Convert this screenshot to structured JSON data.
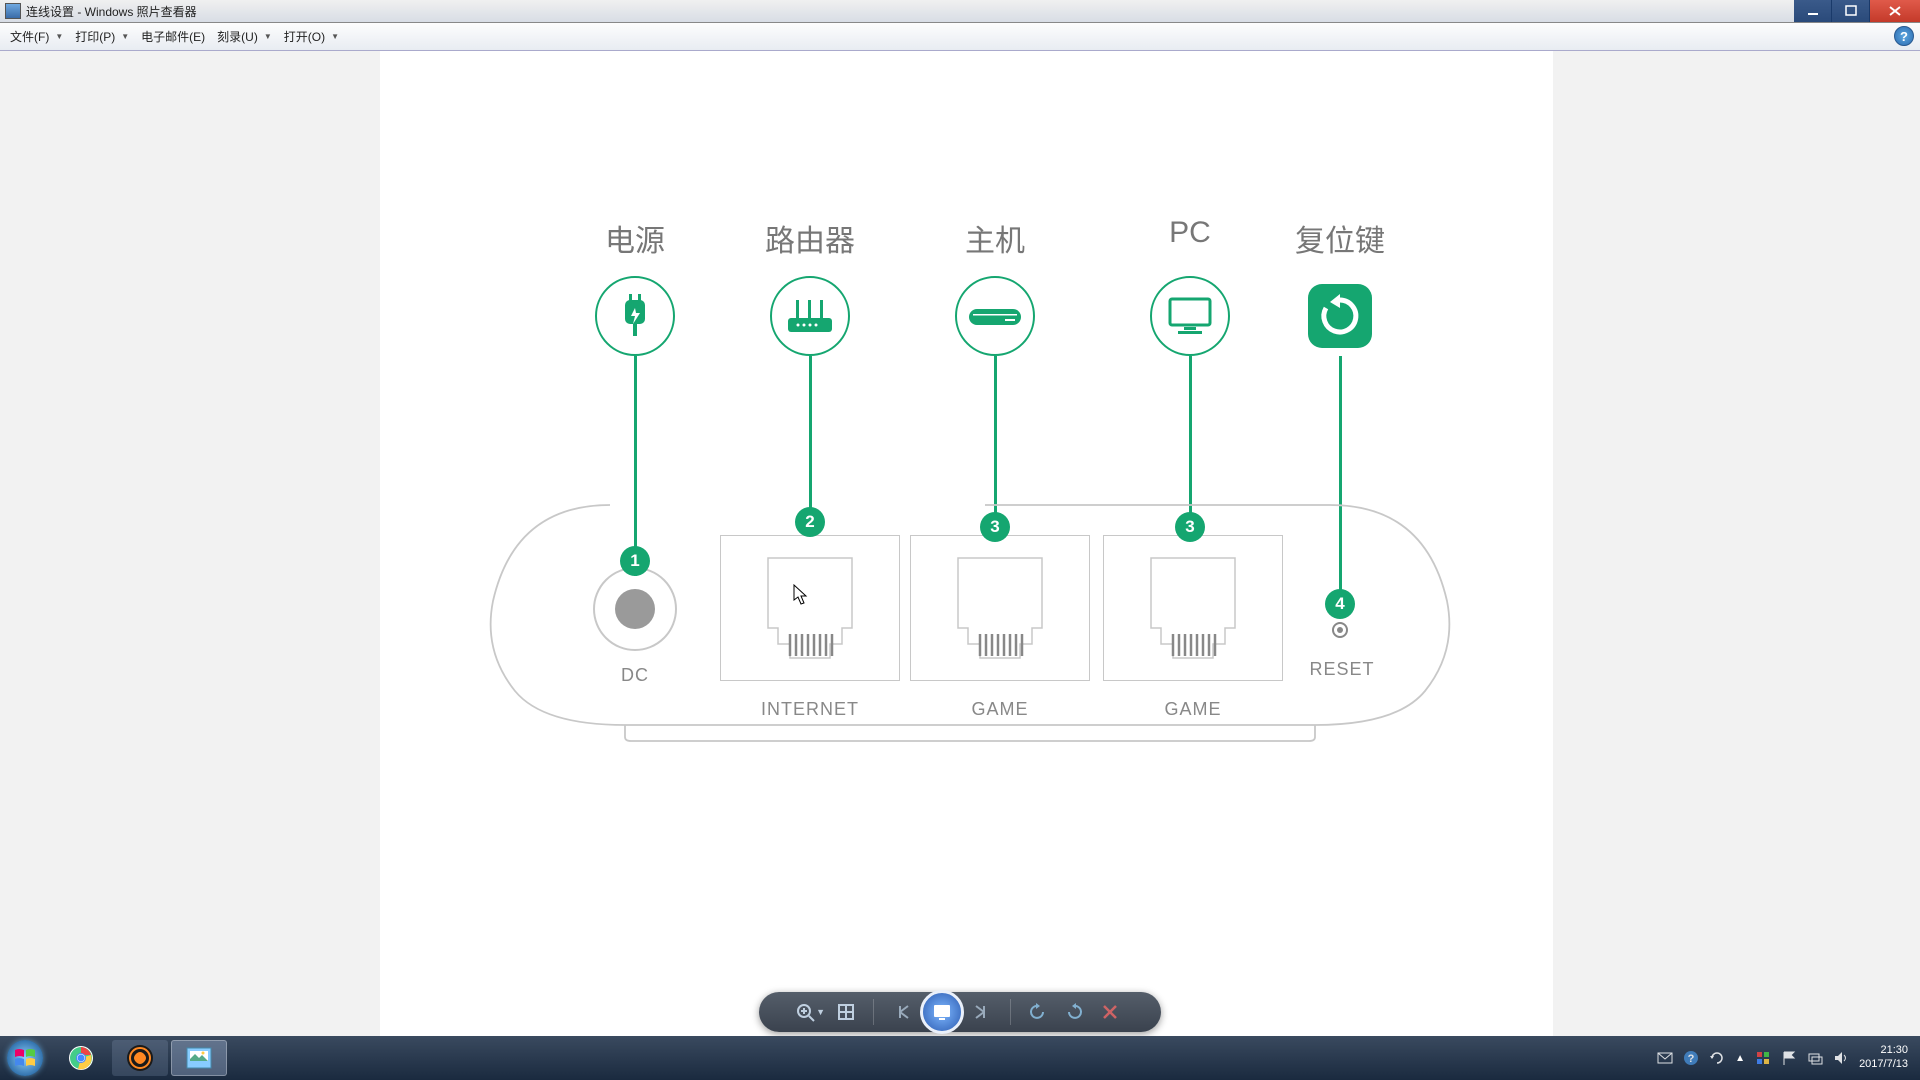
{
  "window": {
    "title": "连线设置 - Windows 照片查看器"
  },
  "menu": {
    "file": "文件(F)",
    "print": "打印(P)",
    "email": "电子邮件(E)",
    "burn": "刻录(U)",
    "open": "打开(O)"
  },
  "diagram": {
    "labels": {
      "power": "电源",
      "router": "路由器",
      "console": "主机",
      "pc": "PC",
      "reset": "复位键"
    },
    "ports": {
      "dc": "DC",
      "internet": "INTERNET",
      "game1": "GAME",
      "game2": "GAME",
      "reset": "RESET"
    },
    "steps": {
      "s1": "1",
      "s2": "2",
      "s3a": "3",
      "s3b": "3",
      "s4": "4"
    }
  },
  "tray": {
    "time": "21:30",
    "date": "2017/7/13"
  }
}
